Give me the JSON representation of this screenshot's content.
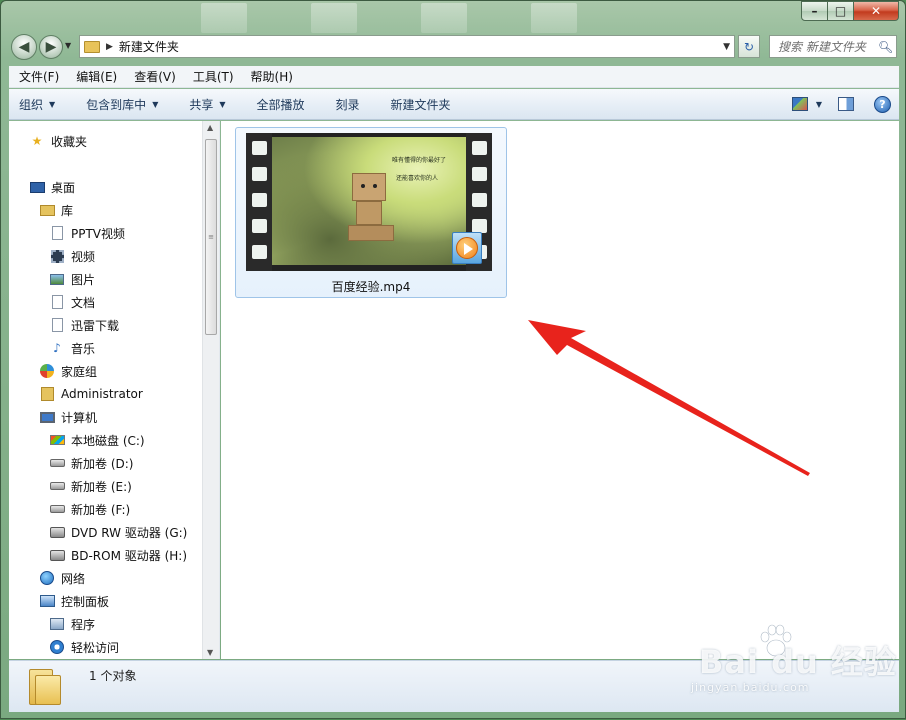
{
  "window": {
    "controls": {
      "minimize": "–",
      "maximize": "□",
      "close": "✕"
    }
  },
  "address": {
    "path": "新建文件夹",
    "search_placeholder": "搜索 新建文件夹"
  },
  "menu": [
    "文件(F)",
    "编辑(E)",
    "查看(V)",
    "工具(T)",
    "帮助(H)"
  ],
  "toolbar": {
    "organize": "组织",
    "include_in_library": "包含到库中",
    "share": "共享",
    "play_all": "全部播放",
    "burn": "刻录",
    "new_folder": "新建文件夹",
    "help_glyph": "?"
  },
  "nav": {
    "favorites": "收藏夹",
    "desktop": "桌面",
    "libraries": "库",
    "pptv": "PPTV视频",
    "videos": "视频",
    "pictures": "图片",
    "documents": "文档",
    "thunder": "迅雷下载",
    "music": "音乐",
    "homegroup": "家庭组",
    "administrator": "Administrator",
    "computer": "计算机",
    "drive_c": "本地磁盘 (C:)",
    "drive_d": "新加卷 (D:)",
    "drive_e": "新加卷 (E:)",
    "drive_f": "新加卷 (F:)",
    "drive_g": "DVD RW 驱动器 (G:)",
    "drive_h": "BD-ROM 驱动器 (H:)",
    "network": "网络",
    "control_panel": "控制面板",
    "programs": "程序",
    "ease_of_access": "轻松访问"
  },
  "file": {
    "name": "百度经验.mp4",
    "thumbnail_caption_1": "唯有懂得的你最好了",
    "thumbnail_caption_2": "还能喜欢你的人"
  },
  "status": {
    "count_text": "1 个对象"
  },
  "watermark": {
    "brand": "Bai du 经验",
    "url": "jingyan.baidu.com"
  },
  "colors": {
    "annotation_arrow": "#e8231c",
    "selection_border": "#9fc4e8",
    "toolbar_text": "#1e395b"
  }
}
